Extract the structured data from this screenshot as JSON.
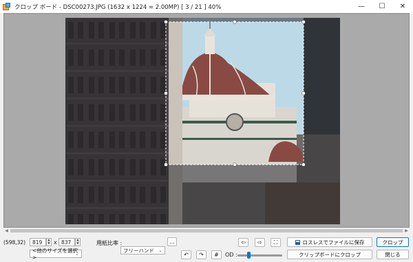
{
  "window": {
    "title": "クロップ ボード  -  DSC00273.JPG  (1632 x 1224 = 2.00MP)  [ 3 / 21 ]   40%",
    "minimize_glyph": "—",
    "maximize_glyph": "☐",
    "close_glyph": "✕"
  },
  "status": {
    "coords": "(598,32)"
  },
  "size": {
    "width": "819",
    "height": "837",
    "times": "x",
    "other_sizes": "<他のサイズを選択>"
  },
  "aspect": {
    "label": "用紙比率 :",
    "value": "フリーハンド",
    "more": "..."
  },
  "tools": {
    "move_left": "⇦",
    "move_right": "⇨",
    "fit_glyph": "⛶",
    "rotate_left": "↶",
    "rotate_right": "↷",
    "grid": "#",
    "od_label": "OD :",
    "od_value": 0.25
  },
  "buttons": {
    "save_lossless": "ロスレスでファイルに保存",
    "crop_to_clipboard": "クリップボードにクロップ",
    "crop": "クロップ",
    "close": "閉じる"
  },
  "colors": {
    "accent": "#0078d4",
    "viewport_bg": "#aaaaaa",
    "sky": "#bcd9e8",
    "dome": "#8a4a44"
  }
}
